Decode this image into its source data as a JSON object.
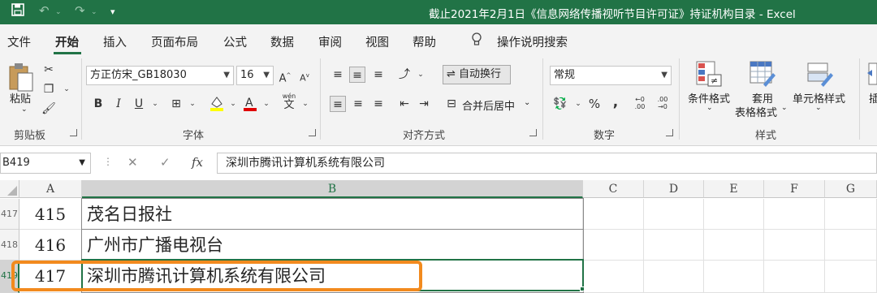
{
  "window": {
    "title": "截止2021年2月1日《信息网络传播视听节目许可证》持证机构目录 - Excel"
  },
  "tabs": [
    "文件",
    "开始",
    "插入",
    "页面布局",
    "公式",
    "数据",
    "审阅",
    "视图",
    "帮助"
  ],
  "active_tab": "开始",
  "tell_me": "操作说明搜索",
  "ribbon": {
    "clipboard": {
      "paste": "粘贴",
      "group": "剪贴板"
    },
    "font": {
      "name": "方正仿宋_GB18030",
      "size": "16",
      "group": "字体",
      "bold": "B",
      "italic": "I",
      "underline": "U",
      "wen": "wén",
      "wen_char": "文"
    },
    "alignment": {
      "wrap": "自动换行",
      "merge": "合并后居中",
      "group": "对齐方式"
    },
    "number": {
      "format": "常规",
      "percent": "%",
      "comma": ",",
      "group": "数字"
    },
    "styles": {
      "conditional": "条件格式",
      "table_format_1": "套用",
      "table_format_2": "表格格式",
      "cell_styles": "单元格样式",
      "group": "样式"
    },
    "cells": {
      "insert": "插"
    }
  },
  "formula_bar": {
    "name_box": "B419",
    "content": "深圳市腾讯计算机系统有限公司",
    "fx": "fx",
    "cancel": "✕",
    "enter": "✓"
  },
  "columns": [
    "A",
    "B",
    "C",
    "D",
    "E",
    "F",
    "G"
  ],
  "rows": [
    {
      "row": "417",
      "a": "415",
      "b": "茂名日报社"
    },
    {
      "row": "418",
      "a": "416",
      "b": "广州市广播电视台"
    },
    {
      "row": "419",
      "a": "417",
      "b": "深圳市腾讯计算机系统有限公司"
    }
  ],
  "colors": {
    "accent": "#217346",
    "highlight": "#f28a1e"
  }
}
